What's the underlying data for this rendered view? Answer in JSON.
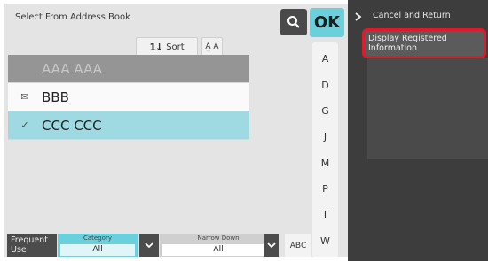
{
  "header": {
    "title": "Select From Address Book",
    "ok_label": "OK"
  },
  "toolbar": {
    "sort_label": "Sort",
    "sort_icon": "1↓",
    "az_icon": "A̲ Ā"
  },
  "list": [
    {
      "name": "AAA AAA",
      "state": "dim",
      "lead": ""
    },
    {
      "name": "BBB",
      "state": "plain",
      "lead": "✉"
    },
    {
      "name": "CCC CCC",
      "state": "selected",
      "lead": "✓"
    }
  ],
  "alpha_index": [
    "A",
    "D",
    "G",
    "J",
    "M",
    "P",
    "T",
    "W"
  ],
  "bottom": {
    "frequent_use": "Frequent Use",
    "category_caption": "Category",
    "category_value": "All",
    "narrow_caption": "Narrow Down",
    "narrow_value": "All",
    "abc_label": "ABC"
  },
  "side_panel": {
    "cancel_label": "Cancel and Return",
    "display_registered_label": "Display Registered Information"
  },
  "colors": {
    "accent": "#6ad1dc",
    "selected_row": "#9fdae2",
    "highlight_border": "#e0192c"
  }
}
